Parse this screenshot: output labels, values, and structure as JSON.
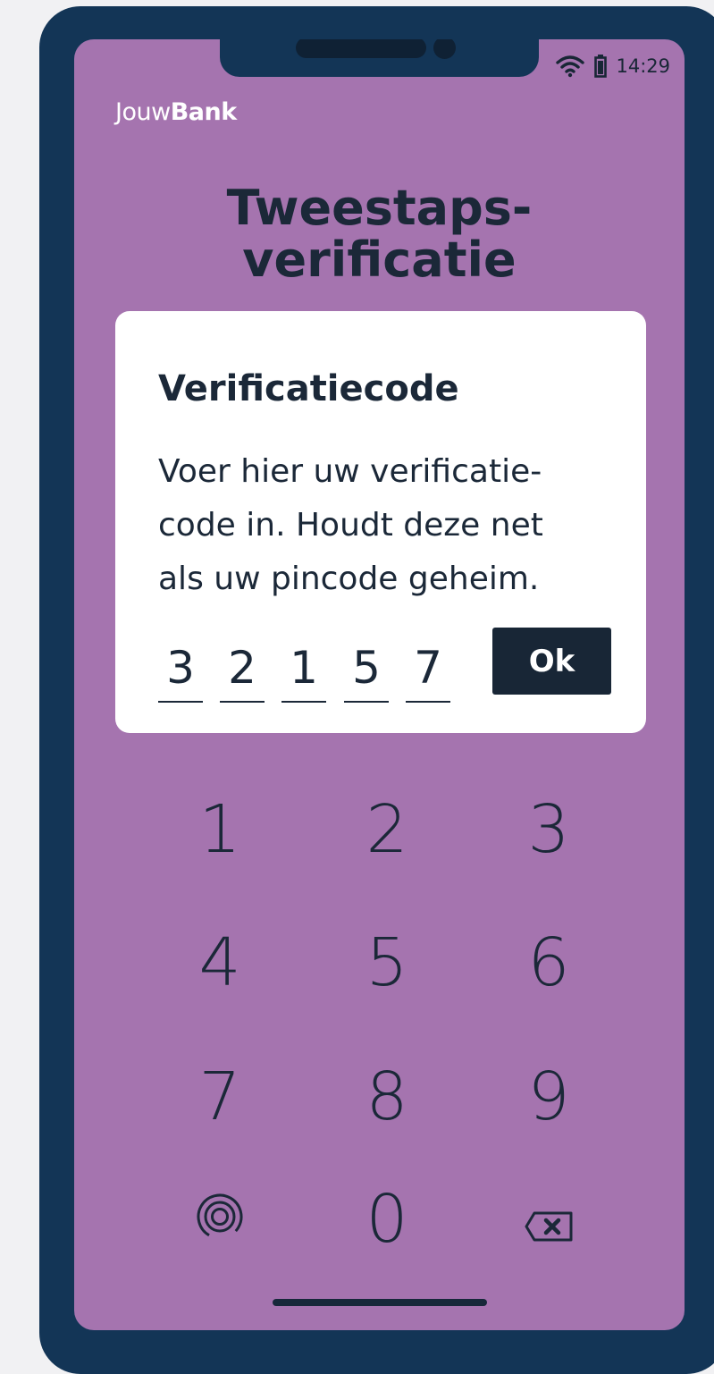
{
  "colors": {
    "page_bg": "#f1f1f3",
    "frame": "#133556",
    "screen": "#a574af",
    "card": "#ffffff",
    "text": "#1b2838",
    "button": "#182636"
  },
  "status_bar": {
    "time": "14:29",
    "icons": [
      "wifi-icon",
      "battery-icon"
    ]
  },
  "brand": {
    "prefix": "Jouw",
    "bold": "Bank"
  },
  "page_title": {
    "line1": "Tweestaps-",
    "line2": "verificatie"
  },
  "card": {
    "title": "Verificatiecode",
    "body_lines": [
      "Voer hier uw verificatie-",
      "code in. Houdt deze net",
      "als uw pincode geheim."
    ],
    "code_digits": [
      "3",
      "2",
      "1",
      "5",
      "7"
    ],
    "ok_label": "Ok"
  },
  "keypad": {
    "keys": [
      "1",
      "2",
      "3",
      "4",
      "5",
      "6",
      "7",
      "8",
      "9",
      "0"
    ],
    "left_icon": "fingerprint-icon",
    "right_icon": "backspace-icon"
  }
}
